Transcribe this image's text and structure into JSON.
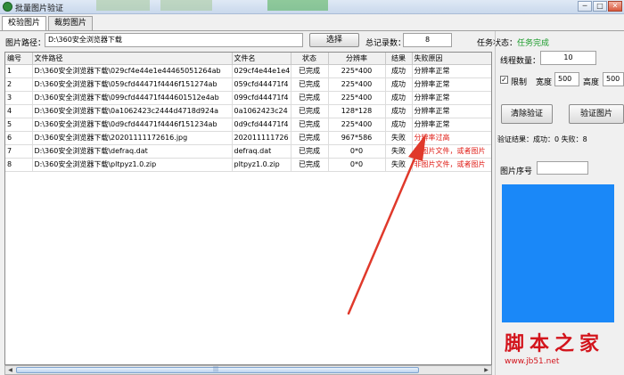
{
  "window": {
    "title": "批量图片验证",
    "min": "─",
    "max": "□",
    "close": "✕"
  },
  "tabs": [
    "校验图片",
    "裁剪图片"
  ],
  "path": {
    "label": "图片路径：",
    "value": "D:\\360安全浏览器下载",
    "browse_label": "选择"
  },
  "records": {
    "label": "总记录数：",
    "value": "8"
  },
  "task": {
    "label": "任务状态：",
    "value": "任务完成"
  },
  "table": {
    "headers": [
      "编号",
      "文件路径",
      "文件名",
      "状态",
      "分辨率",
      "结果",
      "失败原因"
    ],
    "rows": [
      [
        "1",
        "D:\\360安全浏览器下载\\029cf4e44e1e44465051264ab",
        "029cf4e44e1e4",
        "已完成",
        "225*400",
        "成功",
        "分辨率正常"
      ],
      [
        "2",
        "D:\\360安全浏览器下载\\059cfd44471f4446f151274ab",
        "059cfd44471f4",
        "已完成",
        "225*400",
        "成功",
        "分辨率正常"
      ],
      [
        "3",
        "D:\\360安全浏览器下载\\099cfd44471f444601512e4ab",
        "099cfd44471f4",
        "已完成",
        "225*400",
        "成功",
        "分辨率正常"
      ],
      [
        "4",
        "D:\\360安全浏览器下载\\0a1062423c2444d4718d924a",
        "0a1062423c24",
        "已完成",
        "128*128",
        "成功",
        "分辨率正常"
      ],
      [
        "5",
        "D:\\360安全浏览器下载\\0d9cfd44471f4446f151234ab",
        "0d9cfd44471f4",
        "已完成",
        "225*400",
        "成功",
        "分辨率正常"
      ],
      [
        "6",
        "D:\\360安全浏览器下载\\20201111172616.jpg",
        "202011111726",
        "已完成",
        "967*586",
        "失败",
        "分辨率过高"
      ],
      [
        "7",
        "D:\\360安全浏览器下载\\defraq.dat",
        "defraq.dat",
        "已完成",
        "0*0",
        "失败",
        "非图片文件，或者图片"
      ],
      [
        "8",
        "D:\\360安全浏览器下载\\pltpyz1.0.zip",
        "pltpyz1.0.zip",
        "已完成",
        "0*0",
        "失败",
        "非图片文件，或者图片"
      ]
    ],
    "failed_color": "#e0201a"
  },
  "scrollbar": {
    "left_arrow": "◀",
    "right_arrow": "▶",
    "grip": "|||"
  },
  "threads": {
    "label": "线程数量：",
    "value": "10"
  },
  "limit": {
    "check_label": "限制",
    "checked_mark": "✓",
    "width_label": "宽度",
    "width_value": "500",
    "height_label": "高度",
    "height_value": "500"
  },
  "buttons": {
    "clear": "清除验证",
    "verify": "验证图片"
  },
  "result": {
    "text": "验证结果：成功：0 失败：8"
  },
  "image_index": {
    "label": "图片序号",
    "value": ""
  },
  "preview_color": "#1a88f8",
  "watermark": {
    "title": "脚本之家",
    "url": "www.jb51.net"
  },
  "accent_green": "#1a9b2a"
}
